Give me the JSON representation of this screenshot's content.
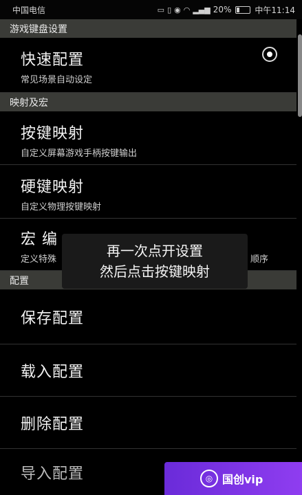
{
  "statusbar": {
    "carrier": "中国电信",
    "battery_percent": "20%",
    "time": "中午11:14",
    "battery_level": 0.2
  },
  "sections": {
    "game_settings": "游戏键盘设置",
    "mapping_macro": "映射及宏",
    "config": "配置"
  },
  "items": {
    "quick_config": {
      "title": "快速配置",
      "subtitle": "常见场景自动设定"
    },
    "key_mapping": {
      "title": "按键映射",
      "subtitle": "自定义屏幕游戏手柄按键输出"
    },
    "hard_key_mapping": {
      "title": "硬键映射",
      "subtitle": "自定义物理按键映射"
    },
    "macro_edit": {
      "title": "宏 编",
      "subtitle": "定义特殊",
      "subtitle_tail": "顺序"
    },
    "save_config": {
      "title": "保存配置"
    },
    "load_config": {
      "title": "载入配置"
    },
    "delete_config": {
      "title": "删除配置"
    },
    "import_config": {
      "title": "导入配置"
    }
  },
  "toast": {
    "line1": "再一次点开设置",
    "line2": "然后点击按键映射"
  },
  "watermark": {
    "text": "国创vip"
  }
}
